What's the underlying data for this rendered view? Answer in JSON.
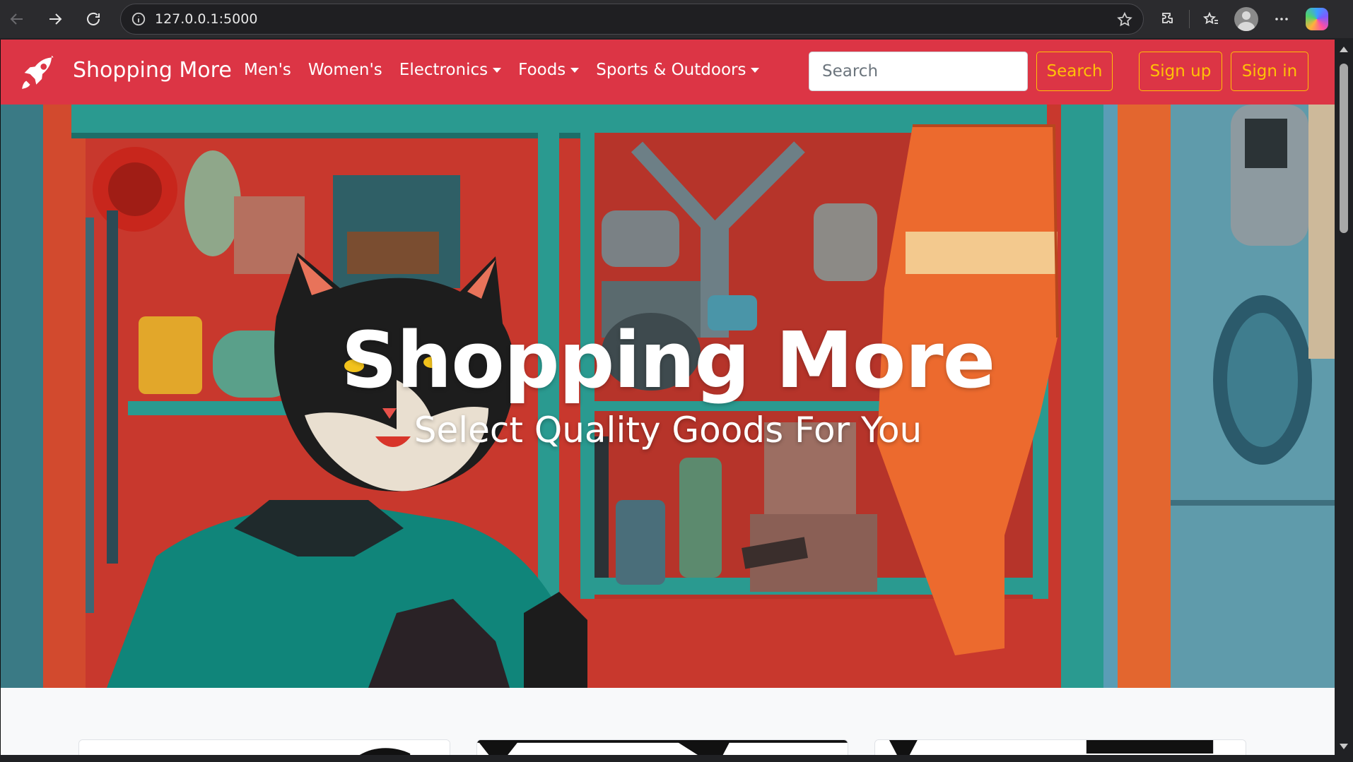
{
  "browser": {
    "url": "127.0.0.1:5000"
  },
  "navbar": {
    "brand": "Shopping More",
    "links": [
      {
        "label": "Men's",
        "dropdown": false
      },
      {
        "label": "Women's",
        "dropdown": false
      },
      {
        "label": "Electronics",
        "dropdown": true
      },
      {
        "label": "Foods",
        "dropdown": true
      },
      {
        "label": "Sports & Outdoors",
        "dropdown": true
      }
    ],
    "search_placeholder": "Search",
    "search_button": "Search",
    "signup_button": "Sign up",
    "signin_button": "Sign in",
    "colors": {
      "bg": "#dc3545",
      "accent": "#ffc107"
    }
  },
  "hero": {
    "title": "Shopping More",
    "subtitle": "Select Quality Goods For You"
  }
}
